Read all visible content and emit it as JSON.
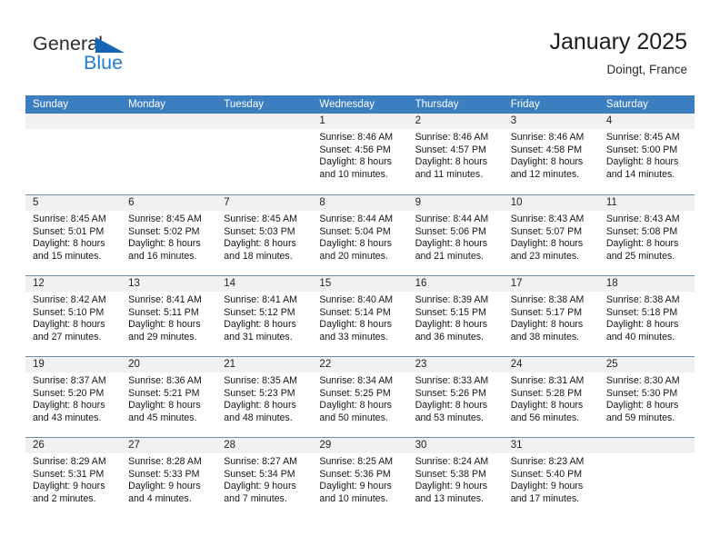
{
  "brand": {
    "name_part1": "General",
    "name_part2": "Blue",
    "triangle_color": "#1565b5",
    "blue_color": "#1f7fd0"
  },
  "header": {
    "title": "January 2025",
    "location": "Doingt, France"
  },
  "theme": {
    "header_row_background": "#3c7fc1",
    "day_band_background": "#f1f1f1",
    "row_separator": "#6a8fb0"
  },
  "weekdays": [
    "Sunday",
    "Monday",
    "Tuesday",
    "Wednesday",
    "Thursday",
    "Friday",
    "Saturday"
  ],
  "weeks": [
    [
      {
        "day": "",
        "sunrise": "",
        "sunset": "",
        "daylight_line1": "",
        "daylight_line2": ""
      },
      {
        "day": "",
        "sunrise": "",
        "sunset": "",
        "daylight_line1": "",
        "daylight_line2": ""
      },
      {
        "day": "",
        "sunrise": "",
        "sunset": "",
        "daylight_line1": "",
        "daylight_line2": ""
      },
      {
        "day": "1",
        "sunrise": "Sunrise: 8:46 AM",
        "sunset": "Sunset: 4:56 PM",
        "daylight_line1": "Daylight: 8 hours",
        "daylight_line2": "and 10 minutes."
      },
      {
        "day": "2",
        "sunrise": "Sunrise: 8:46 AM",
        "sunset": "Sunset: 4:57 PM",
        "daylight_line1": "Daylight: 8 hours",
        "daylight_line2": "and 11 minutes."
      },
      {
        "day": "3",
        "sunrise": "Sunrise: 8:46 AM",
        "sunset": "Sunset: 4:58 PM",
        "daylight_line1": "Daylight: 8 hours",
        "daylight_line2": "and 12 minutes."
      },
      {
        "day": "4",
        "sunrise": "Sunrise: 8:45 AM",
        "sunset": "Sunset: 5:00 PM",
        "daylight_line1": "Daylight: 8 hours",
        "daylight_line2": "and 14 minutes."
      }
    ],
    [
      {
        "day": "5",
        "sunrise": "Sunrise: 8:45 AM",
        "sunset": "Sunset: 5:01 PM",
        "daylight_line1": "Daylight: 8 hours",
        "daylight_line2": "and 15 minutes."
      },
      {
        "day": "6",
        "sunrise": "Sunrise: 8:45 AM",
        "sunset": "Sunset: 5:02 PM",
        "daylight_line1": "Daylight: 8 hours",
        "daylight_line2": "and 16 minutes."
      },
      {
        "day": "7",
        "sunrise": "Sunrise: 8:45 AM",
        "sunset": "Sunset: 5:03 PM",
        "daylight_line1": "Daylight: 8 hours",
        "daylight_line2": "and 18 minutes."
      },
      {
        "day": "8",
        "sunrise": "Sunrise: 8:44 AM",
        "sunset": "Sunset: 5:04 PM",
        "daylight_line1": "Daylight: 8 hours",
        "daylight_line2": "and 20 minutes."
      },
      {
        "day": "9",
        "sunrise": "Sunrise: 8:44 AM",
        "sunset": "Sunset: 5:06 PM",
        "daylight_line1": "Daylight: 8 hours",
        "daylight_line2": "and 21 minutes."
      },
      {
        "day": "10",
        "sunrise": "Sunrise: 8:43 AM",
        "sunset": "Sunset: 5:07 PM",
        "daylight_line1": "Daylight: 8 hours",
        "daylight_line2": "and 23 minutes."
      },
      {
        "day": "11",
        "sunrise": "Sunrise: 8:43 AM",
        "sunset": "Sunset: 5:08 PM",
        "daylight_line1": "Daylight: 8 hours",
        "daylight_line2": "and 25 minutes."
      }
    ],
    [
      {
        "day": "12",
        "sunrise": "Sunrise: 8:42 AM",
        "sunset": "Sunset: 5:10 PM",
        "daylight_line1": "Daylight: 8 hours",
        "daylight_line2": "and 27 minutes."
      },
      {
        "day": "13",
        "sunrise": "Sunrise: 8:41 AM",
        "sunset": "Sunset: 5:11 PM",
        "daylight_line1": "Daylight: 8 hours",
        "daylight_line2": "and 29 minutes."
      },
      {
        "day": "14",
        "sunrise": "Sunrise: 8:41 AM",
        "sunset": "Sunset: 5:12 PM",
        "daylight_line1": "Daylight: 8 hours",
        "daylight_line2": "and 31 minutes."
      },
      {
        "day": "15",
        "sunrise": "Sunrise: 8:40 AM",
        "sunset": "Sunset: 5:14 PM",
        "daylight_line1": "Daylight: 8 hours",
        "daylight_line2": "and 33 minutes."
      },
      {
        "day": "16",
        "sunrise": "Sunrise: 8:39 AM",
        "sunset": "Sunset: 5:15 PM",
        "daylight_line1": "Daylight: 8 hours",
        "daylight_line2": "and 36 minutes."
      },
      {
        "day": "17",
        "sunrise": "Sunrise: 8:38 AM",
        "sunset": "Sunset: 5:17 PM",
        "daylight_line1": "Daylight: 8 hours",
        "daylight_line2": "and 38 minutes."
      },
      {
        "day": "18",
        "sunrise": "Sunrise: 8:38 AM",
        "sunset": "Sunset: 5:18 PM",
        "daylight_line1": "Daylight: 8 hours",
        "daylight_line2": "and 40 minutes."
      }
    ],
    [
      {
        "day": "19",
        "sunrise": "Sunrise: 8:37 AM",
        "sunset": "Sunset: 5:20 PM",
        "daylight_line1": "Daylight: 8 hours",
        "daylight_line2": "and 43 minutes."
      },
      {
        "day": "20",
        "sunrise": "Sunrise: 8:36 AM",
        "sunset": "Sunset: 5:21 PM",
        "daylight_line1": "Daylight: 8 hours",
        "daylight_line2": "and 45 minutes."
      },
      {
        "day": "21",
        "sunrise": "Sunrise: 8:35 AM",
        "sunset": "Sunset: 5:23 PM",
        "daylight_line1": "Daylight: 8 hours",
        "daylight_line2": "and 48 minutes."
      },
      {
        "day": "22",
        "sunrise": "Sunrise: 8:34 AM",
        "sunset": "Sunset: 5:25 PM",
        "daylight_line1": "Daylight: 8 hours",
        "daylight_line2": "and 50 minutes."
      },
      {
        "day": "23",
        "sunrise": "Sunrise: 8:33 AM",
        "sunset": "Sunset: 5:26 PM",
        "daylight_line1": "Daylight: 8 hours",
        "daylight_line2": "and 53 minutes."
      },
      {
        "day": "24",
        "sunrise": "Sunrise: 8:31 AM",
        "sunset": "Sunset: 5:28 PM",
        "daylight_line1": "Daylight: 8 hours",
        "daylight_line2": "and 56 minutes."
      },
      {
        "day": "25",
        "sunrise": "Sunrise: 8:30 AM",
        "sunset": "Sunset: 5:30 PM",
        "daylight_line1": "Daylight: 8 hours",
        "daylight_line2": "and 59 minutes."
      }
    ],
    [
      {
        "day": "26",
        "sunrise": "Sunrise: 8:29 AM",
        "sunset": "Sunset: 5:31 PM",
        "daylight_line1": "Daylight: 9 hours",
        "daylight_line2": "and 2 minutes."
      },
      {
        "day": "27",
        "sunrise": "Sunrise: 8:28 AM",
        "sunset": "Sunset: 5:33 PM",
        "daylight_line1": "Daylight: 9 hours",
        "daylight_line2": "and 4 minutes."
      },
      {
        "day": "28",
        "sunrise": "Sunrise: 8:27 AM",
        "sunset": "Sunset: 5:34 PM",
        "daylight_line1": "Daylight: 9 hours",
        "daylight_line2": "and 7 minutes."
      },
      {
        "day": "29",
        "sunrise": "Sunrise: 8:25 AM",
        "sunset": "Sunset: 5:36 PM",
        "daylight_line1": "Daylight: 9 hours",
        "daylight_line2": "and 10 minutes."
      },
      {
        "day": "30",
        "sunrise": "Sunrise: 8:24 AM",
        "sunset": "Sunset: 5:38 PM",
        "daylight_line1": "Daylight: 9 hours",
        "daylight_line2": "and 13 minutes."
      },
      {
        "day": "31",
        "sunrise": "Sunrise: 8:23 AM",
        "sunset": "Sunset: 5:40 PM",
        "daylight_line1": "Daylight: 9 hours",
        "daylight_line2": "and 17 minutes."
      },
      {
        "day": "",
        "sunrise": "",
        "sunset": "",
        "daylight_line1": "",
        "daylight_line2": ""
      }
    ]
  ]
}
